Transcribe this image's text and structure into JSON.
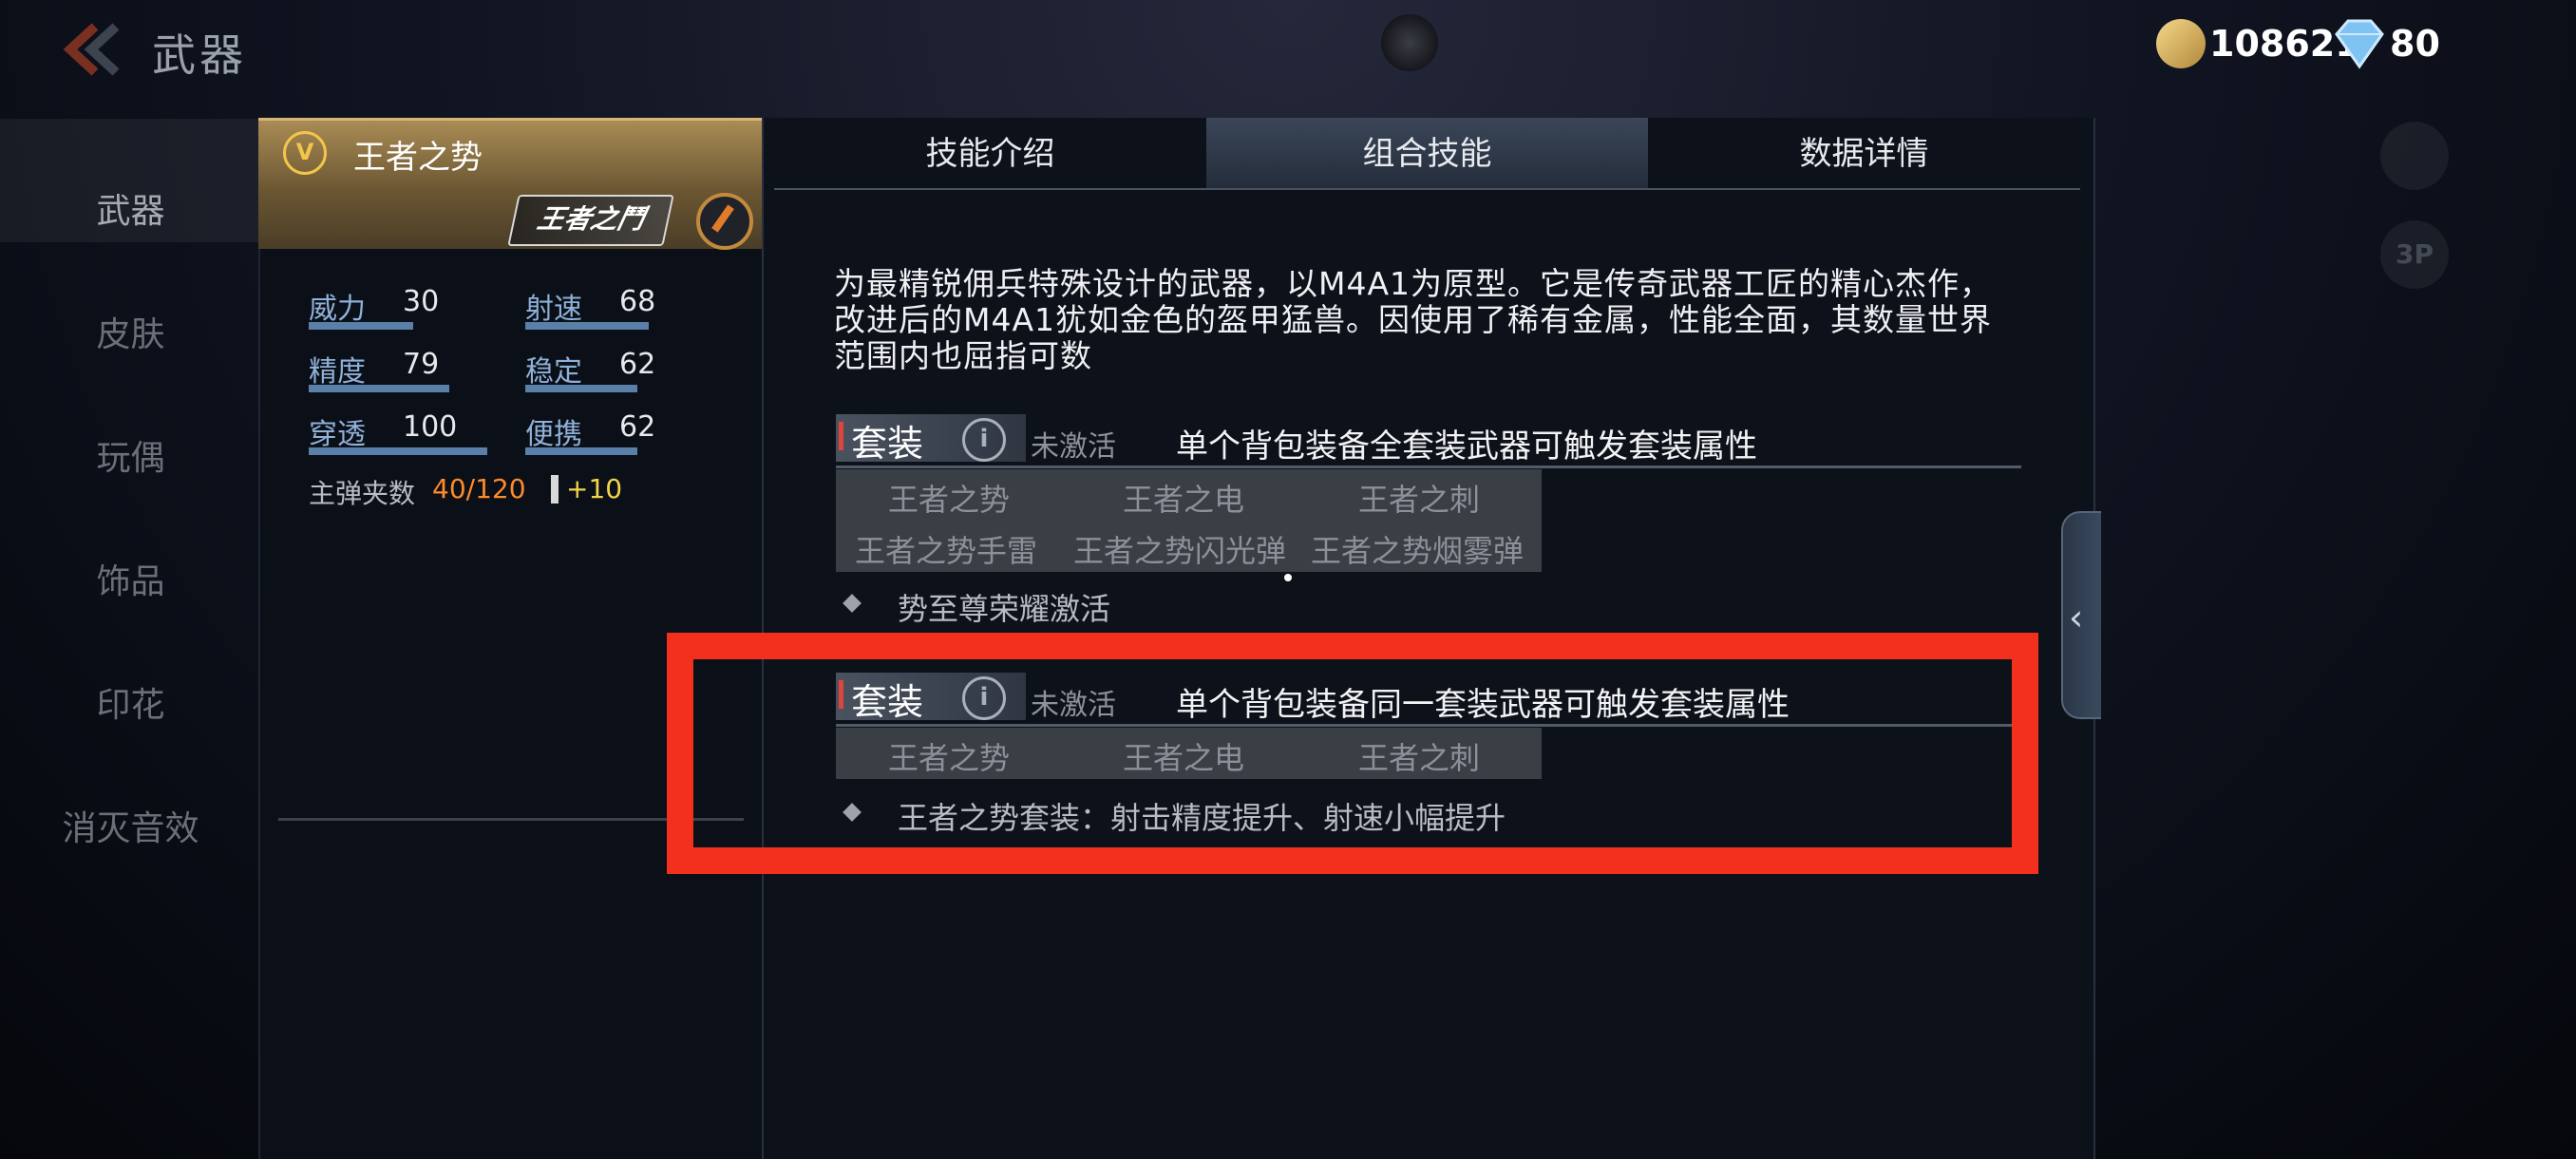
{
  "topbar": {
    "title": "武器",
    "gold": "108621",
    "diamonds": "80"
  },
  "nav": [
    "武器",
    "皮肤",
    "玩偶",
    "饰品",
    "印花",
    "消灭音效"
  ],
  "weapon": {
    "name": "王者之势",
    "badge": "V",
    "logo_text": "王者之鬥",
    "stats": [
      {
        "label": "威力",
        "value": "30"
      },
      {
        "label": "射速",
        "value": "68"
      },
      {
        "label": "精度",
        "value": "79"
      },
      {
        "label": "稳定",
        "value": "62"
      },
      {
        "label": "穿透",
        "value": "100"
      },
      {
        "label": "便携",
        "value": "62"
      }
    ],
    "ammo_label": "主弹夹数",
    "ammo_value": "40/120",
    "ammo_bonus": "+10"
  },
  "tabs": [
    "技能介绍",
    "组合技能",
    "数据详情"
  ],
  "description": "为最精锐佣兵特殊设计的武器，以M4A1为原型。它是传奇武器工匠的精心杰作，改进后的M4A1犹如金色的盔甲猛兽。因使用了稀有金属，性能全面，其数量世界范围内也屈指可数",
  "sets": [
    {
      "tag": "套装",
      "status": "未激活",
      "desc": "单个背包装备全套装武器可触发套装属性",
      "items_row1": [
        "王者之势",
        "王者之电",
        "王者之刺"
      ],
      "items_row2": [
        "王者之势手雷",
        "王者之势闪光弹",
        "王者之势烟雾弹"
      ],
      "effect": "势至尊荣耀激活"
    },
    {
      "tag": "套装",
      "status": "未激活",
      "desc": "单个背包装备同一套装武器可触发套装属性",
      "items_row1": [
        "王者之势",
        "王者之电",
        "王者之刺"
      ],
      "effect": "王者之势套装：射击精度提升、射速小幅提升"
    }
  ],
  "side_buttons": {
    "view_mode": "3P"
  },
  "colors": {
    "highlight_box": "#f2301d",
    "ammo": "#ff8a2a",
    "bonus": "#f1d44a"
  }
}
